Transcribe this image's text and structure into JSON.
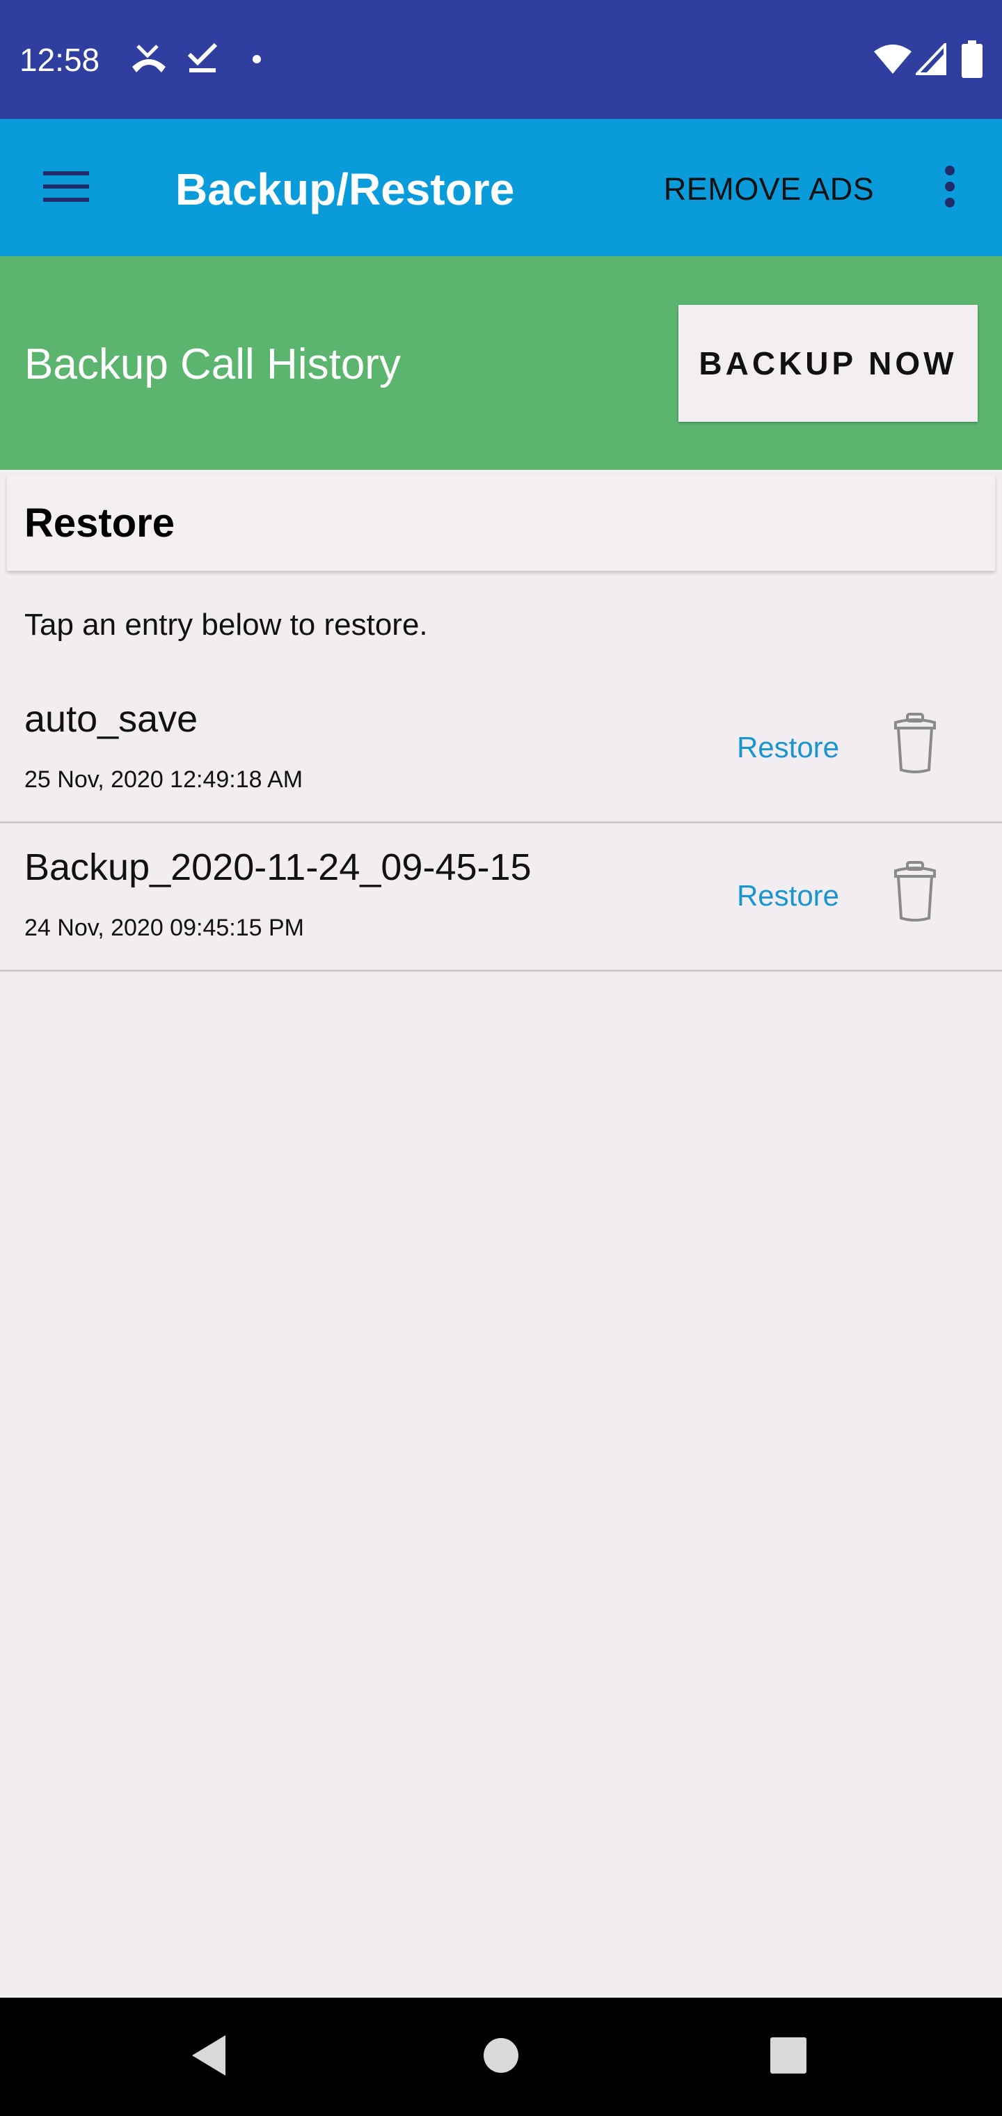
{
  "status_bar": {
    "time": "12:58",
    "icons": [
      "missed-call-icon",
      "download-done-icon",
      "notification-dot-icon",
      "wifi-icon",
      "signal-icon",
      "battery-icon"
    ]
  },
  "app_bar": {
    "title": "Backup/Restore",
    "remove_ads_label": "REMOVE ADS",
    "menu_icon": "hamburger-menu-icon",
    "overflow_icon": "more-vert-icon",
    "color": "#0a9bdb"
  },
  "backup": {
    "label": "Backup Call History",
    "button_label": "BACKUP NOW",
    "color": "#5cb56f"
  },
  "restore": {
    "title": "Restore",
    "hint": "Tap an entry below to restore.",
    "entries": [
      {
        "name": "auto_save",
        "date": "25 Nov, 2020 12:49:18 AM",
        "action_label": "Restore",
        "delete_icon": "trash-icon"
      },
      {
        "name": "Backup_2020-11-24_09-45-15",
        "date": "24 Nov, 2020 09:45:15 PM",
        "action_label": "Restore",
        "delete_icon": "trash-icon"
      }
    ]
  },
  "nav_bar": {
    "icons": [
      "back-icon",
      "home-icon",
      "recents-icon"
    ]
  }
}
